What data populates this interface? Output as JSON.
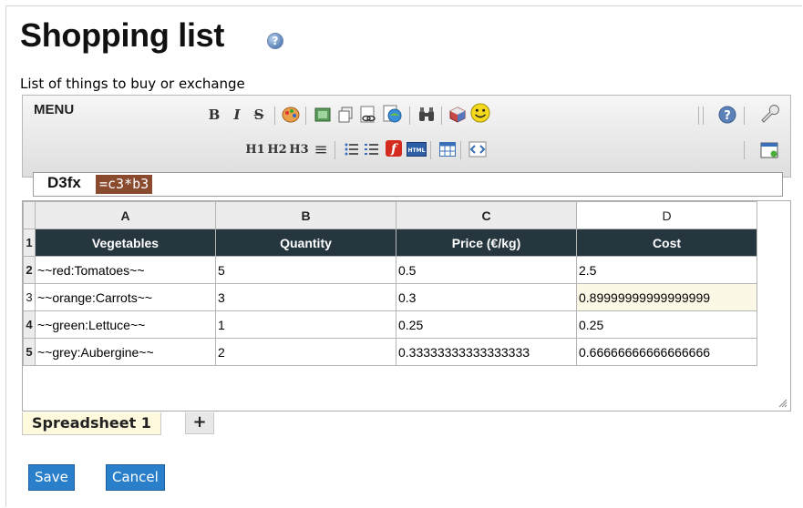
{
  "page": {
    "title": "Shopping list",
    "help_glyph": "?",
    "description": "List of things to buy or exchange"
  },
  "toolbar": {
    "menu_label": "MENU",
    "row1": [
      {
        "name": "bold-icon",
        "glyph": "B"
      },
      {
        "name": "italic-icon",
        "glyph": "I"
      },
      {
        "name": "strikethrough-icon",
        "glyph": "S"
      },
      {
        "name": "color-palette-icon",
        "glyph": "🎨"
      },
      {
        "name": "image-icon",
        "glyph": "▣"
      },
      {
        "name": "copy-icon",
        "glyph": "⧉"
      },
      {
        "name": "link-icon",
        "glyph": "🔗"
      },
      {
        "name": "external-link-icon",
        "glyph": "🌐"
      },
      {
        "name": "find-icon",
        "glyph": "🔍"
      },
      {
        "name": "plugin-icon",
        "glyph": "🧩"
      },
      {
        "name": "smiley-icon",
        "glyph": "☺"
      },
      {
        "name": "help-icon",
        "glyph": "?"
      },
      {
        "name": "wrench-icon",
        "glyph": "🔧"
      }
    ],
    "row2": [
      {
        "name": "h1-icon",
        "glyph": "H1"
      },
      {
        "name": "h2-icon",
        "glyph": "H2"
      },
      {
        "name": "h3-icon",
        "glyph": "H3"
      },
      {
        "name": "align-center-icon",
        "glyph": "≡"
      },
      {
        "name": "bullet-list-icon",
        "glyph": "☰"
      },
      {
        "name": "numbered-list-icon",
        "glyph": "☷"
      },
      {
        "name": "flash-icon",
        "glyph": "ƒ"
      },
      {
        "name": "html-icon",
        "glyph": "HTML"
      },
      {
        "name": "table-icon",
        "glyph": "▦"
      },
      {
        "name": "code-icon",
        "glyph": "◈"
      },
      {
        "name": "new-window-icon",
        "glyph": "⊞"
      }
    ]
  },
  "formula": {
    "cell_label": "D3fx",
    "value": "=c3*b3"
  },
  "sheet": {
    "columns": [
      "A",
      "B",
      "C",
      "D"
    ],
    "rows": [
      {
        "num": "1",
        "cells": [
          "Vegetables",
          "Quantity",
          "Price (€/kg)",
          "Cost"
        ]
      },
      {
        "num": "2",
        "cells": [
          "~~red:Tomatoes~~",
          "5",
          "0.5",
          "2.5"
        ]
      },
      {
        "num": "3",
        "cells": [
          "~~orange:Carrots~~",
          "3",
          "0.3",
          "0.89999999999999999"
        ]
      },
      {
        "num": "4",
        "cells": [
          "~~green:Lettuce~~",
          "1",
          "0.25",
          "0.25"
        ]
      },
      {
        "num": "5",
        "cells": [
          "~~grey:Aubergine~~",
          "2",
          "0.33333333333333333",
          "0.66666666666666666"
        ]
      }
    ]
  },
  "tabs": {
    "sheet_tab": "Spreadsheet 1",
    "add_tab": "+"
  },
  "buttons": {
    "save": "Save",
    "cancel": "Cancel"
  },
  "colors": {
    "header_bg": "#25363f",
    "button_bg": "#2a7fcb",
    "formula_highlight": "#8a4a2e",
    "active_cell_bg": "#fbf8e6"
  }
}
